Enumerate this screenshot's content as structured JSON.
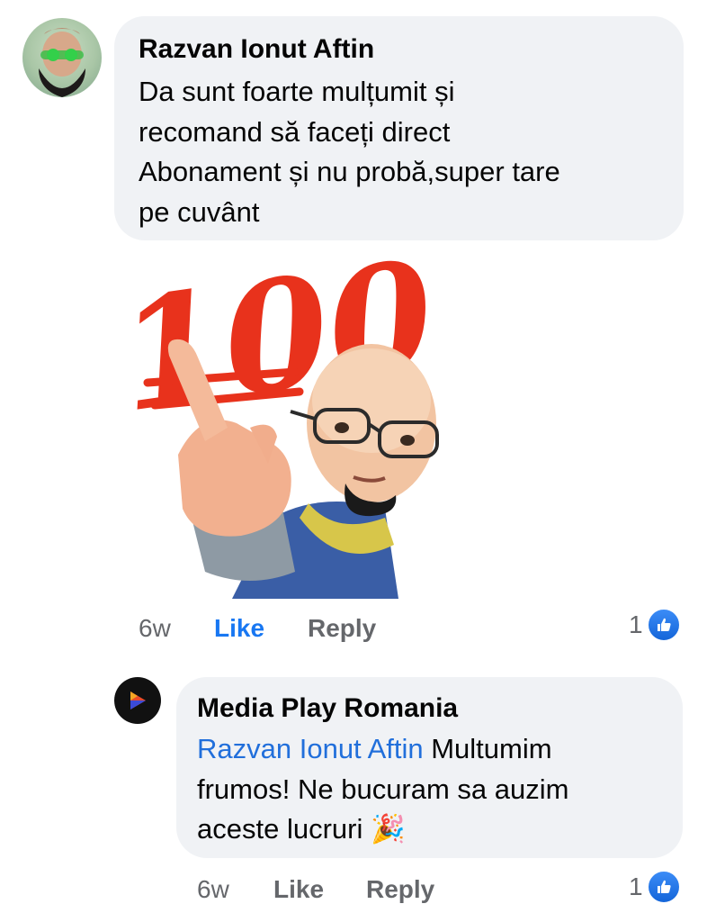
{
  "comment": {
    "author": "Razvan Ionut Aftin",
    "lines": [
      "Da sunt foarte mulțumit și",
      "recomand să faceți direct",
      "Abonament și nu probă,super tare",
      "pe cuvânt"
    ],
    "sticker_text": "100",
    "time": "6w",
    "like_label": "Like",
    "reply_label": "Reply",
    "reaction_count": "1",
    "reaction_icon": "thumbs-up-icon",
    "like_state_color": "#1877f2"
  },
  "reply": {
    "author": "Media Play Romania",
    "mention": "Razvan Ionut Aftin",
    "line1_rest": " Multumim",
    "line2": "frumos! Ne bucuram sa auzim",
    "line3": "aceste lucruri",
    "emoji": "🎉",
    "time": "6w",
    "like_label": "Like",
    "reply_label": "Reply",
    "reaction_count": "1",
    "reaction_icon": "thumbs-up-icon"
  },
  "colors": {
    "bubble": "#f0f2f5",
    "mention": "#216fdb",
    "meta": "#65676b",
    "like_active": "#1877f2"
  }
}
